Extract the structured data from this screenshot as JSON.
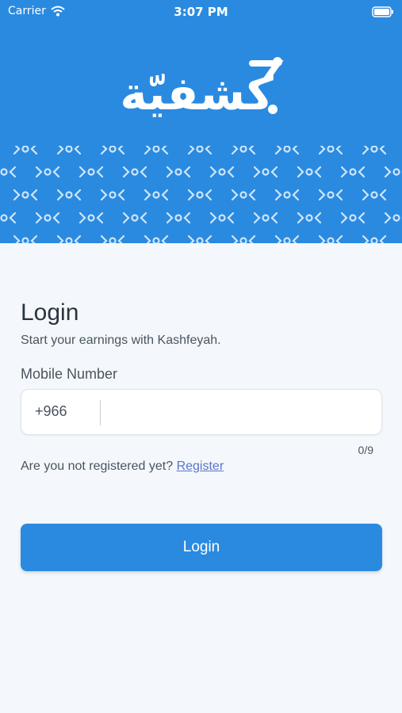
{
  "status_bar": {
    "carrier": "Carrier",
    "time": "3:07 PM"
  },
  "brand": {
    "logo_text": "كشفيّة",
    "color": "#2a8ae0"
  },
  "login": {
    "title": "Login",
    "subtitle": "Start your earnings with Kashfeyah.",
    "mobile_label": "Mobile Number",
    "country_code": "+966",
    "phone_value": "",
    "char_counter": "0/9",
    "register_prompt": "Are you not registered yet?",
    "register_link": "Register",
    "submit_label": "Login"
  }
}
